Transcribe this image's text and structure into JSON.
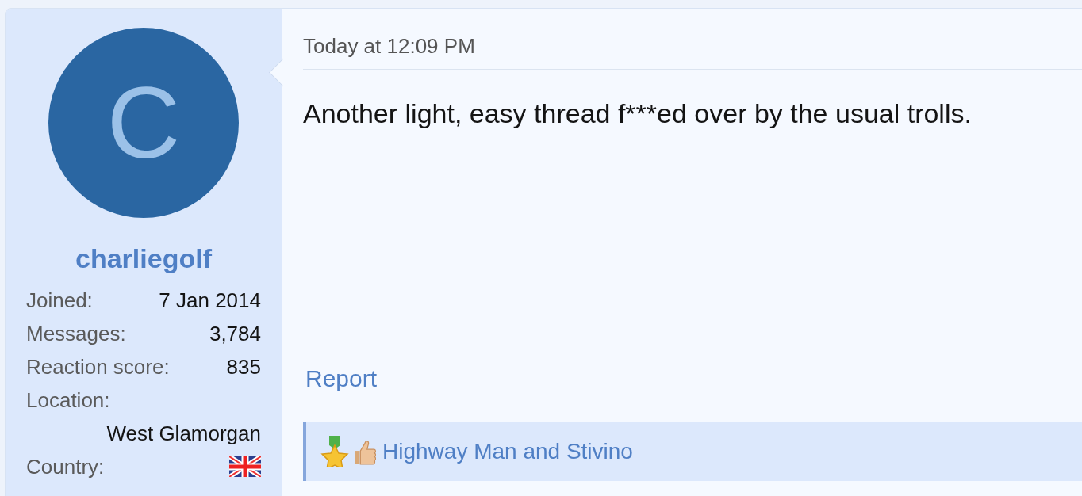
{
  "user": {
    "avatar_letter": "C",
    "username": "charliegolf",
    "stats": [
      {
        "label": "Joined:",
        "value": "7 Jan 2014",
        "kind": "inline"
      },
      {
        "label": "Messages:",
        "value": "3,784",
        "kind": "inline"
      },
      {
        "label": "Reaction score:",
        "value": "835",
        "kind": "inline"
      },
      {
        "label": "Location:",
        "value": "West Glamorgan",
        "kind": "stacked"
      },
      {
        "label": "Country:",
        "kind": "flag"
      }
    ]
  },
  "post": {
    "time": "Today at 12:09 PM",
    "body": "Another light, easy thread f***ed over by the usual trolls.",
    "actions": [
      "Report"
    ],
    "reactions": {
      "text": "Highway Man and Stivino"
    }
  }
}
